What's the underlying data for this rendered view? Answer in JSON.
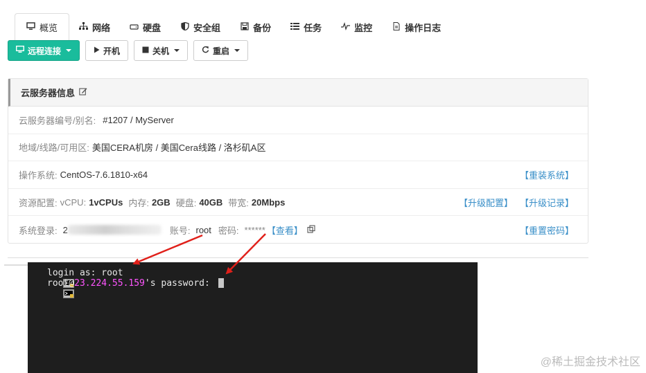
{
  "tabs": [
    {
      "label": "概览",
      "icon": "monitor-icon",
      "active": true
    },
    {
      "label": "网络",
      "icon": "network-icon"
    },
    {
      "label": "硬盘",
      "icon": "hdd-icon"
    },
    {
      "label": "安全组",
      "icon": "shield-icon"
    },
    {
      "label": "备份",
      "icon": "floppy-icon"
    },
    {
      "label": "任务",
      "icon": "list-icon"
    },
    {
      "label": "监控",
      "icon": "pulse-icon"
    },
    {
      "label": "操作日志",
      "icon": "file-icon"
    }
  ],
  "toolbar": {
    "remote_label": "远程连接",
    "start_label": "开机",
    "shutdown_label": "关机",
    "restart_label": "重启",
    "accent_color": "#1abc9c"
  },
  "panel": {
    "title": "云服务器信息",
    "id_label": "云服务器编号/别名:",
    "id_value": "#1207 / MyServer",
    "region_label": "地域/线路/可用区:",
    "region_value": "美国CERA机房 / 美国Cera线路 / 洛杉矶A区",
    "os_label": "操作系统:",
    "os_value": "CentOS-7.6.1810-x64",
    "reinstall_link": "【重装系统】",
    "res_label": "资源配置:",
    "vcpu_label": "vCPU:",
    "vcpu_value": "1vCPUs",
    "mem_label": "内存:",
    "mem_value": "2GB",
    "disk_label": "硬盘:",
    "disk_value": "40GB",
    "bw_label": "带宽:",
    "bw_value": "20Mbps",
    "upgrade_link": "【升级配置】",
    "upgrade_log_link": "【升级记录】",
    "login_label": "系统登录:",
    "login_prefix": "2",
    "account_label": "账号:",
    "account_value": "root",
    "password_label": "密码:",
    "password_value": "******",
    "view_link": "【查看】",
    "reset_link": "【重置密码】"
  },
  "terminal": {
    "line1": "login as: root",
    "line2_user": "root@",
    "line2_host": "23.224.55.159",
    "line2_suffix": "'s password: "
  },
  "watermark": "@稀土掘金技术社区"
}
